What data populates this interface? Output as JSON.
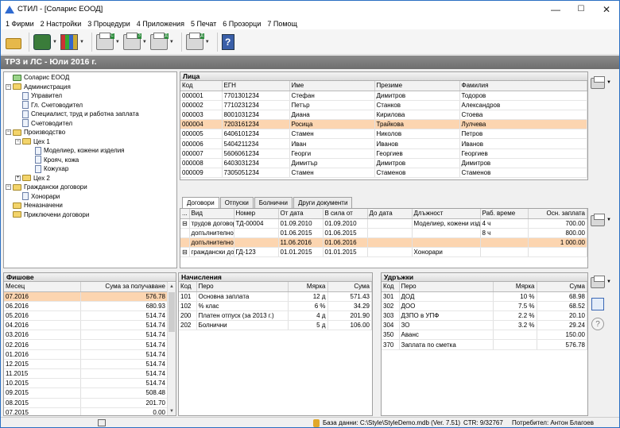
{
  "window": {
    "title": "СТИЛ - [Соларис ЕООД]",
    "min": "—",
    "max": "☐",
    "close": "✕"
  },
  "menu": [
    "1 Фирми",
    "2 Настройки",
    "3 Процедури",
    "4 Приложения",
    "5 Печат",
    "6 Прозорци",
    "7 Помощ"
  ],
  "toolbar": {
    "ls": "ЛС",
    "trz": "ТЗ",
    "gd": "ГД",
    "dd": "ДД",
    "help": "?"
  },
  "band": "ТРЗ и ЛС - Юли 2016 г.",
  "tree": [
    {
      "label": "Соларис ЕООД",
      "lvl": 0,
      "kind": "root"
    },
    {
      "label": "Администрация",
      "lvl": 1,
      "kind": "folder",
      "ex": "−"
    },
    {
      "label": "Управител",
      "lvl": 2,
      "kind": "page"
    },
    {
      "label": "Гл. Счетоводител",
      "lvl": 2,
      "kind": "page"
    },
    {
      "label": "Специалист, труд и работна заплата",
      "lvl": 2,
      "kind": "page"
    },
    {
      "label": "Счетоводител",
      "lvl": 2,
      "kind": "page"
    },
    {
      "label": "Производство",
      "lvl": 1,
      "kind": "folder",
      "ex": "−"
    },
    {
      "label": "Цех 1",
      "lvl": 2,
      "kind": "folder",
      "ex": "−"
    },
    {
      "label": "Моделиер, кожени изделия",
      "lvl": 3,
      "kind": "page"
    },
    {
      "label": "Крояч, кожа",
      "lvl": 3,
      "kind": "page"
    },
    {
      "label": "Кожухар",
      "lvl": 3,
      "kind": "page"
    },
    {
      "label": "Цех 2",
      "lvl": 2,
      "kind": "folder",
      "ex": "+"
    },
    {
      "label": "Граждански договори",
      "lvl": 1,
      "kind": "folder",
      "ex": "−"
    },
    {
      "label": "Хонорари",
      "lvl": 2,
      "kind": "page"
    },
    {
      "label": "Неназначени",
      "lvl": 0,
      "kind": "folder"
    },
    {
      "label": "Приключени договори",
      "lvl": 0,
      "kind": "folder"
    }
  ],
  "persons": {
    "title": "Лица",
    "cols": [
      "Код",
      "ЕГН",
      "Име",
      "Презиме",
      "Фамилия"
    ],
    "rows": [
      [
        "000001",
        "7701301234",
        "Стефан",
        "Димитров",
        "Тодоров"
      ],
      [
        "000002",
        "7710231234",
        "Петър",
        "Станков",
        "Александров"
      ],
      [
        "000003",
        "8001031234",
        "Диана",
        "Кирилова",
        "Стоева"
      ],
      [
        "000004",
        "7203161234",
        "Росица",
        "Трайкова",
        "Лулчева"
      ],
      [
        "000005",
        "6406101234",
        "Стамен",
        "Николов",
        "Петров"
      ],
      [
        "000006",
        "5404211234",
        "Иван",
        "Иванов",
        "Иванов"
      ],
      [
        "000007",
        "5606061234",
        "Георги",
        "Георгиев",
        "Георгиев"
      ],
      [
        "000008",
        "6403031234",
        "Димитър",
        "Димитров",
        "Димитров"
      ],
      [
        "000009",
        "7305051234",
        "Стамен",
        "Стаменов",
        "Стаменов"
      ]
    ],
    "selected": 3
  },
  "tabs": [
    "Договори",
    "Отпуски",
    "Болнични",
    "Други документи"
  ],
  "contracts": {
    "cols": [
      "...",
      "Вид",
      "Номер",
      "От дата",
      "В сила от",
      "До дата",
      "Длъжност",
      "Раб. време",
      "Осн. заплата"
    ],
    "rows": [
      [
        "⊟",
        "трудов договор",
        "ТД-00004",
        "01.09.2010",
        "01.09.2010",
        "",
        "Моделиер, кожени изделия",
        "4 ч",
        "700.00"
      ],
      [
        "",
        "допълнително",
        "",
        "01.06.2015",
        "01.06.2015",
        "",
        "",
        "8 ч",
        "800.00"
      ],
      [
        "",
        "допълнително",
        "",
        "11.06.2016",
        "01.06.2016",
        "",
        "",
        "",
        "1 000.00"
      ],
      [
        "⊟",
        "граждански договор",
        "ГД-123",
        "01.01.2015",
        "01.01.2015",
        "",
        "Хонорари",
        "",
        ""
      ]
    ],
    "selected": 2
  },
  "payslips": {
    "title": "Фишове",
    "cols": [
      "Месец",
      "Сума за получаване"
    ],
    "rows": [
      [
        "07.2016",
        "576.78"
      ],
      [
        "06.2016",
        "680.93"
      ],
      [
        "05.2016",
        "514.74"
      ],
      [
        "04.2016",
        "514.74"
      ],
      [
        "03.2016",
        "514.74"
      ],
      [
        "02.2016",
        "514.74"
      ],
      [
        "01.2016",
        "514.74"
      ],
      [
        "12.2015",
        "514.74"
      ],
      [
        "11.2015",
        "514.74"
      ],
      [
        "10.2015",
        "514.74"
      ],
      [
        "09.2015",
        "508.48"
      ],
      [
        "08.2015",
        "201.70"
      ],
      [
        "07.2015",
        "0.00"
      ]
    ],
    "selected": 0
  },
  "accruals": {
    "title": "Начисления",
    "cols": [
      "Код",
      "Перо",
      "Мярка",
      "Сума"
    ],
    "rows": [
      [
        "101",
        "Основна заплата",
        "12 д",
        "571.43"
      ],
      [
        "102",
        "% клас",
        "6 %",
        "34.29"
      ],
      [
        "200",
        "Платен отпуск (за 2013 г.)",
        "4 д",
        "201.90"
      ],
      [
        "202",
        "Болнични",
        "5 д",
        "106.00"
      ]
    ]
  },
  "deductions": {
    "title": "Удръжки",
    "cols": [
      "Код",
      "Перо",
      "Мярка",
      "Сума"
    ],
    "rows": [
      [
        "301",
        "ДОД",
        "10 %",
        "68.98"
      ],
      [
        "302",
        "ДОО",
        "7.5 %",
        "68.52"
      ],
      [
        "303",
        "ДЗПО в УПФ",
        "2.2 %",
        "20.10"
      ],
      [
        "304",
        "ЗО",
        "3.2 %",
        "29.24"
      ],
      [
        "350",
        "Аванс",
        "",
        "150.00"
      ],
      [
        "370",
        "Заплата по сметка",
        "",
        "576.78"
      ]
    ]
  },
  "status": {
    "db": "База данни: C:\\Style\\StyleDemo.mdb (Ver. 7.51)",
    "ctr": "CTR: 9/32767",
    "user": "Потребител: Антон Благоев"
  },
  "colors": {
    "selected": "#fcd5b0",
    "accent": "#2b6fc2"
  }
}
